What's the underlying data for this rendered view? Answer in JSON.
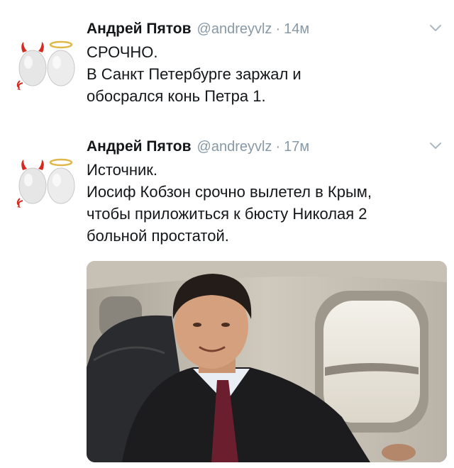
{
  "tweets": [
    {
      "author": {
        "display_name": "Андрей Пятов",
        "handle": "@andreyvlz",
        "avatar_icon": "devil-and-angel-eggs-icon"
      },
      "separator": "·",
      "time": "14м",
      "text_lines": [
        "СРОЧНО.",
        "В Санкт Петербурге заржал и",
        "обосрался конь Петра 1."
      ],
      "menu_icon": "chevron-down-icon"
    },
    {
      "author": {
        "display_name": "Андрей Пятов",
        "handle": "@andreyvlz",
        "avatar_icon": "devil-and-angel-eggs-icon"
      },
      "separator": "·",
      "time": "17м",
      "text_lines": [
        "Источник.",
        "Иосиф Кобзон срочно вылетел в Крым,",
        "чтобы приложиться к бюсту Николая 2",
        "больной простатой."
      ],
      "menu_icon": "chevron-down-icon",
      "media": {
        "type": "photo",
        "content": "man-in-suit-seated-by-airplane-window"
      }
    }
  ],
  "colors": {
    "text": "#14171a",
    "muted": "#8899a6",
    "background": "#ffffff"
  }
}
